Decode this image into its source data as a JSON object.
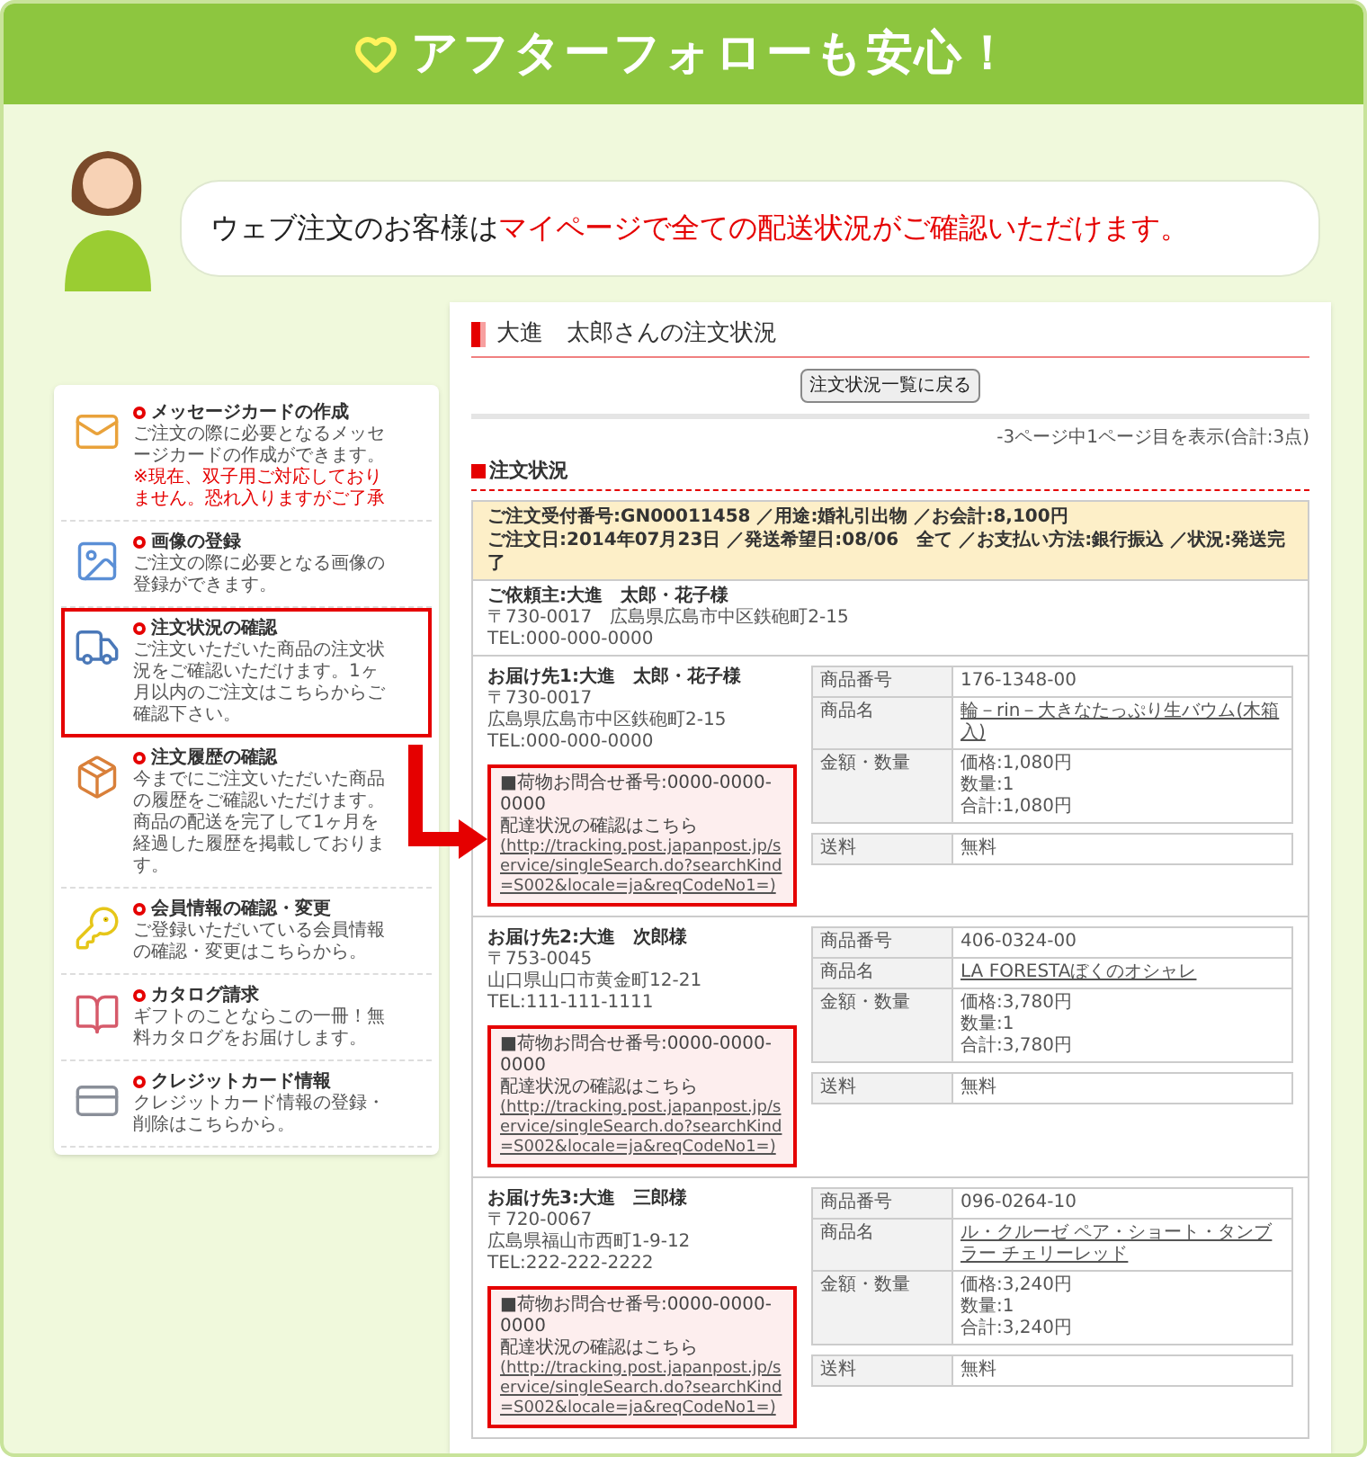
{
  "banner": {
    "title": "アフターフォローも安心！"
  },
  "bubble": {
    "lead": "ウェブ注文のお客様は",
    "emphasis": "マイページで全ての配送状況がご確認いただけます。"
  },
  "menu": {
    "items": [
      {
        "kind": "card",
        "title": "メッセージカードの作成",
        "description": "ご注文の際に必要となるメッセージカードの作成ができます。",
        "note": "※現在、双子用ご対応しておりません。恐れ入りますがご了承",
        "highlighted": false
      },
      {
        "kind": "image",
        "title": "画像の登録",
        "description": "ご注文の際に必要となる画像の登録ができます。",
        "highlighted": false
      },
      {
        "kind": "truck",
        "title": "注文状況の確認",
        "description": "ご注文いただいた商品の注文状況をご確認いただけます。1ヶ月以内のご注文はこちらからご確認下さい。",
        "highlighted": true
      },
      {
        "kind": "box",
        "title": "注文履歴の確認",
        "description": "今までにご注文いただいた商品の履歴をご確認いただけます。商品の配送を完了して1ヶ月を経過した履歴を掲載しております。",
        "highlighted": false
      },
      {
        "kind": "key",
        "title": "会員情報の確認・変更",
        "description": "ご登録いただいている会員情報の確認・変更はこちらから。",
        "highlighted": false
      },
      {
        "kind": "catalog",
        "title": "カタログ請求",
        "description": "ギフトのことならこの一冊！無料カタログをお届けします。",
        "highlighted": false
      },
      {
        "kind": "credit",
        "title": "クレジットカード情報",
        "description": "クレジットカード情報の登録・削除はこちらから。",
        "highlighted": false
      }
    ]
  },
  "order_page": {
    "title": "大進　太郎さんの注文状況",
    "back_button": "注文状況一覧に戻る",
    "page_info": "-3ページ中1ページ目を表示(合計:3点)",
    "section_title": "注文状況",
    "summary": [
      "ご注文受付番号:GN00011458 ／用途:婚礼引出物 ／お会計:8,100円",
      "ご注文日:2014年07月23日 ／発送希望日:08/06　全て ／お支払い方法:銀行振込 ／状況:発送完了"
    ],
    "requester": {
      "name": "ご依頼主:大進　太郎・花子様",
      "address": "〒730-0017　広島県広島市中区鉄砲町2-15",
      "tel": "TEL:000-000-0000"
    },
    "shipments": [
      {
        "recipient": "お届け先1:大進　太郎・花子様",
        "postal": "〒730-0017",
        "address": "広島県広島市中区鉄砲町2-15",
        "tel": "TEL:000-000-0000",
        "tracking_label": "■荷物お問合せ番号:0000-0000-0000",
        "tracking_note": "配達状況の確認はこちら",
        "tracking_url": "(http://tracking.post.japanpost.jp/service/singleSearch.do?searchKind=S002&locale=ja&reqCodeNo1=)",
        "highlighted": true,
        "details": [
          {
            "kind": "text",
            "label": "商品番号",
            "lines": [
              "176-1348-00"
            ]
          },
          {
            "kind": "link",
            "label": "商品名",
            "lines": [
              "輪－rin－大きなたっぷり生バウム(木箱入)"
            ]
          },
          {
            "kind": "text",
            "label": "金額・数量",
            "lines": [
              "価格:1,080円",
              "数量:1",
              "合計:1,080円"
            ]
          }
        ],
        "shipping": {
          "label": "送料",
          "value": "無料"
        }
      },
      {
        "recipient": "お届け先2:大進　次郎様",
        "postal": "〒753-0045",
        "address": "山口県山口市黄金町12-21",
        "tel": "TEL:111-111-1111",
        "tracking_label": "■荷物お問合せ番号:0000-0000-0000",
        "tracking_note": "配達状況の確認はこちら",
        "tracking_url": "(http://tracking.post.japanpost.jp/service/singleSearch.do?searchKind=S002&locale=ja&reqCodeNo1=)",
        "highlighted": true,
        "details": [
          {
            "kind": "text",
            "label": "商品番号",
            "lines": [
              "406-0324-00"
            ]
          },
          {
            "kind": "link",
            "label": "商品名",
            "lines": [
              "LA FORESTAぼくのオシャレ"
            ]
          },
          {
            "kind": "text",
            "label": "金額・数量",
            "lines": [
              "価格:3,780円",
              "数量:1",
              "合計:3,780円"
            ]
          }
        ],
        "shipping": {
          "label": "送料",
          "value": "無料"
        }
      },
      {
        "recipient": "お届け先3:大進　三郎様",
        "postal": "〒720-0067",
        "address": "広島県福山市西町1-9-12",
        "tel": "TEL:222-222-2222",
        "tracking_label": "■荷物お問合せ番号:0000-0000-0000",
        "tracking_note": "配達状況の確認はこちら",
        "tracking_url": "(http://tracking.post.japanpost.jp/service/singleSearch.do?searchKind=S002&locale=ja&reqCodeNo1=)",
        "highlighted": true,
        "details": [
          {
            "kind": "text",
            "label": "商品番号",
            "lines": [
              "096-0264-10"
            ]
          },
          {
            "kind": "link",
            "label": "商品名",
            "lines": [
              "ル・クルーゼ ペア・ショート・タンブラー チェリーレッド"
            ]
          },
          {
            "kind": "text",
            "label": "金額・数量",
            "lines": [
              "価格:3,240円",
              "数量:1",
              "合計:3,240円"
            ]
          }
        ],
        "shipping": {
          "label": "送料",
          "value": "無料"
        }
      }
    ]
  }
}
